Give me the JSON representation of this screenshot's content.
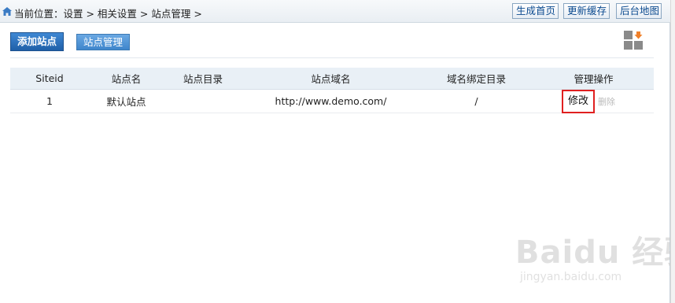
{
  "topbar": {
    "breadcrumb": "当前位置：设置 > 相关设置 > 站点管理 >",
    "buttons": {
      "generate_home": "生成首页",
      "update_cache": "更新缓存",
      "admin_map": "后台地图"
    }
  },
  "toolbar": {
    "add_site": "添加站点",
    "site_manage": "站点管理"
  },
  "table": {
    "headers": [
      "Siteid",
      "站点名",
      "站点目录",
      "站点域名",
      "域名绑定目录",
      "管理操作"
    ],
    "rows": [
      {
        "siteid": "1",
        "name": "默认站点",
        "dir": "",
        "domain": "http://www.demo.com/",
        "bind_dir": "/",
        "edit": "修改",
        "delete": "删除"
      }
    ]
  },
  "watermark": {
    "brand": "Baidu 经验",
    "url": "jingyan.baidu.com"
  },
  "colors": {
    "primary_button": "#2a6fbf",
    "link_blue": "#0b4a8f",
    "highlight_red": "#e02020",
    "header_bg": "#e9f0f6"
  }
}
